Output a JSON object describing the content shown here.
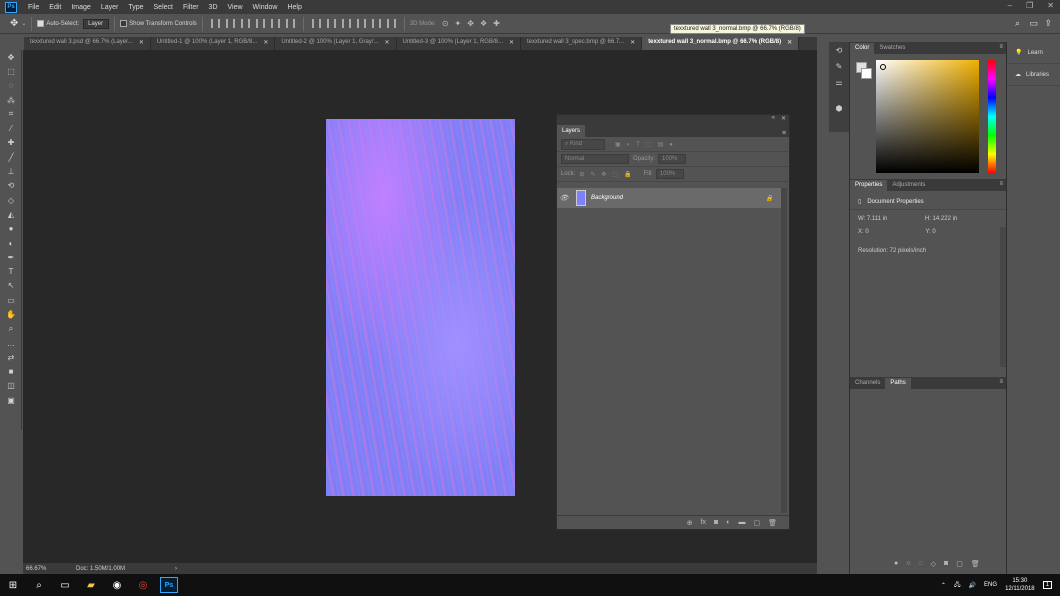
{
  "app": {
    "logo": "Ps",
    "menu": [
      "File",
      "Edit",
      "Image",
      "Layer",
      "Type",
      "Select",
      "Filter",
      "3D",
      "View",
      "Window",
      "Help"
    ],
    "window_controls": [
      "–",
      "❐",
      "✕"
    ]
  },
  "options_bar": {
    "auto_select_label": "Auto-Select:",
    "auto_select_checked": true,
    "auto_select_target": "Layer",
    "transform_label": "Show Transform Controls",
    "transform_checked": false,
    "mode_3d_label": "3D Mode:"
  },
  "tooltip": "texxtured wall 3_normal.bmp @ 66.7% (RGB/8)",
  "doc_tabs": [
    {
      "label": "texxtured wall 3.psd @ 66.7% (Layer...",
      "active": false
    },
    {
      "label": "Untitled-1 @ 100% (Layer 1, RGB/8...",
      "active": false
    },
    {
      "label": "Untitled-2 @ 100% (Layer 1, Gray/...",
      "active": false
    },
    {
      "label": "Untitled-3 @ 100% (Layer 1, RGB/8...",
      "active": false
    },
    {
      "label": "texxtured wall 3_spec.bmp @ 66.7...",
      "active": false
    },
    {
      "label": "texxtured wall 3_normal.bmp @ 66.7% (RGB/8)",
      "active": true
    }
  ],
  "tab_close": "✕",
  "tools": [
    "move-tool",
    "marquee-tool",
    "lasso-tool",
    "magic-wand-tool",
    "crop-tool",
    "eyedropper-tool",
    "healing-tool",
    "brush-tool",
    "clone-stamp-tool",
    "history-brush-tool",
    "eraser-tool",
    "paint-bucket-tool",
    "blur-tool",
    "dodge-tool",
    "pen-tool",
    "type-tool",
    "path-select-tool",
    "rectangle-tool",
    "hand-tool",
    "zoom-tool",
    "more-tools",
    "color-swap-tool",
    "fg-bg-colors",
    "quick-mask-tool",
    "screen-mode-tool"
  ],
  "tool_glyphs": [
    "✥",
    "⬚",
    "◌",
    "⁂",
    "⌗",
    "⁄",
    "✚",
    "╱",
    "⊥",
    "⟲",
    "◇",
    "◭",
    "●",
    "◐",
    "✒",
    "T",
    "↖",
    "▭",
    "✋",
    "⌕",
    "…",
    "⇄",
    "■",
    "◫",
    "▣"
  ],
  "status": {
    "zoom": "66.67%",
    "doc": "Doc: 1.50M/1.00M",
    "arrow": "›"
  },
  "layers_panel": {
    "header_controls": [
      "«",
      "✕"
    ],
    "tab": "Layers",
    "menu": "≡",
    "filter_placeholder": "⌕ Kind",
    "blend_mode": "Normal",
    "opacity_label": "Opacity:",
    "opacity_value": "100%",
    "lock_label": "Lock:",
    "fill_label": "Fill:",
    "fill_value": "100%",
    "layers": [
      {
        "name": "Background",
        "visible": true,
        "locked": true
      }
    ],
    "footer_icons": [
      "⊕",
      "fx",
      "◙",
      "◐",
      "▬",
      "▢",
      "🗑"
    ]
  },
  "right_panels": {
    "color_tabs": [
      "Color",
      "Swatches"
    ],
    "properties_tabs": [
      "Properties",
      "Adjustments"
    ],
    "properties_title": "Document Properties",
    "w_label": "W:",
    "w_value": "7.111 in",
    "h_label": "H:",
    "h_value": "14.222 in",
    "x_label": "X:",
    "x_value": "0",
    "y_label": "Y:",
    "y_value": "0",
    "resolution": "Resolution: 72 pixels/inch",
    "paths_tabs": [
      "Channels",
      "Paths"
    ],
    "menu": "≡"
  },
  "far_right": {
    "learn": "Learn",
    "libraries": "Libraries"
  },
  "taskbar": {
    "lang": "ENG",
    "time": "15:30",
    "date": "12/11/2018",
    "notification_count": "1"
  },
  "colors": {
    "accent": "#31a8ff",
    "canvas_bg": "#282828",
    "panel_bg": "#535353",
    "normal_map": "#8080ff"
  }
}
